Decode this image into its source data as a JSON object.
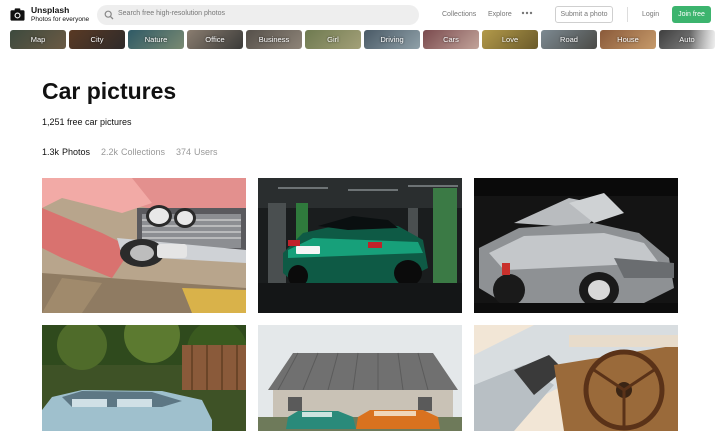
{
  "header": {
    "brand_name": "Unsplash",
    "brand_tagline": "Photos for everyone",
    "search_placeholder": "Search free high-resolution photos",
    "nav_collections": "Collections",
    "nav_explore": "Explore",
    "submit_label": "Submit a photo",
    "login_label": "Login",
    "join_label": "Join free",
    "join_color": "#3cb46e"
  },
  "topics": [
    {
      "label": "Map"
    },
    {
      "label": "City"
    },
    {
      "label": "Nature"
    },
    {
      "label": "Office"
    },
    {
      "label": "Business"
    },
    {
      "label": "Girl"
    },
    {
      "label": "Driving"
    },
    {
      "label": "Cars"
    },
    {
      "label": "Love"
    },
    {
      "label": "Road"
    },
    {
      "label": "House"
    },
    {
      "label": "Auto"
    }
  ],
  "page": {
    "title": "Car pictures",
    "subtitle": "1,251 free car pictures"
  },
  "tabs": [
    {
      "count": "1.3k",
      "label": "Photos"
    },
    {
      "count": "2.2k",
      "label": "Collections"
    },
    {
      "count": "374",
      "label": "Users"
    }
  ]
}
